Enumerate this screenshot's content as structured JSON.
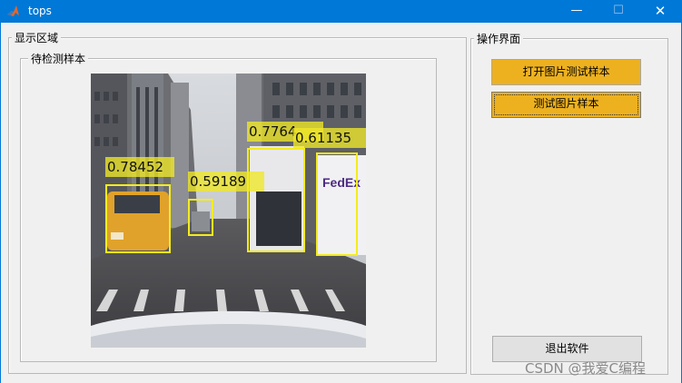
{
  "window": {
    "title": "tops",
    "controls": {
      "minimize": "—",
      "maximize": "☐",
      "close": "✕"
    }
  },
  "display_panel": {
    "title": "显示区域"
  },
  "sample_panel": {
    "title": "待检测样本"
  },
  "ops_panel": {
    "title": "操作界面"
  },
  "buttons": {
    "open_image": "打开图片测试样本",
    "test_image": "测试图片样本",
    "exit": "退出软件"
  },
  "colors": {
    "titlebar": "#0078d7",
    "button_accent": "#edb120",
    "detection_box": "#f3ec1f"
  },
  "detections": [
    {
      "label": "car",
      "score": "0.78452"
    },
    {
      "label": "car",
      "score": "0.59189"
    },
    {
      "label": "truck",
      "score": "0.7764"
    },
    {
      "label": "truck",
      "score": "0.61135"
    }
  ],
  "watermark": "CSDN @我爱C编程"
}
